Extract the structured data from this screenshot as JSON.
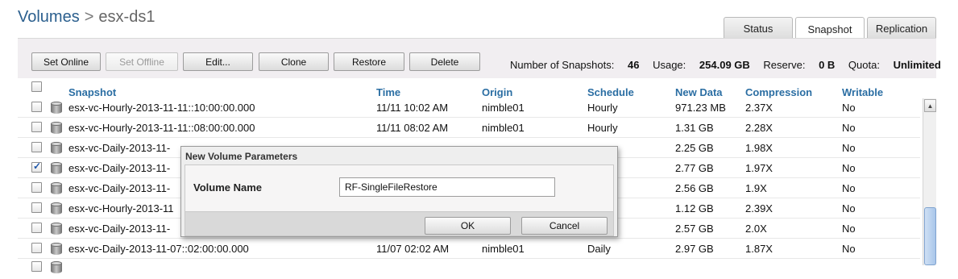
{
  "breadcrumb": {
    "root": "Volumes",
    "separator": ">",
    "current": "esx-ds1"
  },
  "tabs": [
    {
      "label": "Status",
      "active": false
    },
    {
      "label": "Snapshot",
      "active": true
    },
    {
      "label": "Replication",
      "active": false
    }
  ],
  "toolbar": {
    "set_online": "Set Online",
    "set_offline": "Set Offline",
    "edit": "Edit...",
    "clone": "Clone",
    "restore": "Restore",
    "delete": "Delete"
  },
  "stats": {
    "snapshots_label": "Number of Snapshots:",
    "snapshots_value": "46",
    "usage_label": "Usage:",
    "usage_value": "254.09 GB",
    "reserve_label": "Reserve:",
    "reserve_value": "0 B",
    "quota_label": "Quota:",
    "quota_value": "Unlimited"
  },
  "table": {
    "columns": [
      "Snapshot",
      "Time",
      "Origin",
      "Schedule",
      "New Data",
      "Compression",
      "Writable"
    ],
    "rows": [
      {
        "checked": false,
        "snapshot": "esx-vc-Hourly-2013-11-11::10:00:00.000",
        "time": "11/11 10:02 AM",
        "origin": "nimble01",
        "schedule": "Hourly",
        "new_data": "971.23 MB",
        "compression": "2.37X",
        "writable": "No"
      },
      {
        "checked": false,
        "snapshot": "esx-vc-Hourly-2013-11-11::08:00:00.000",
        "time": "11/11 08:02 AM",
        "origin": "nimble01",
        "schedule": "Hourly",
        "new_data": "1.31 GB",
        "compression": "2.28X",
        "writable": "No"
      },
      {
        "checked": false,
        "snapshot": "esx-vc-Daily-2013-11-",
        "time": "",
        "origin": "",
        "schedule": "",
        "new_data": "2.25 GB",
        "compression": "1.98X",
        "writable": "No"
      },
      {
        "checked": true,
        "snapshot": "esx-vc-Daily-2013-11-",
        "time": "",
        "origin": "",
        "schedule": "",
        "new_data": "2.77 GB",
        "compression": "1.97X",
        "writable": "No"
      },
      {
        "checked": false,
        "snapshot": "esx-vc-Daily-2013-11-",
        "time": "",
        "origin": "",
        "schedule": "",
        "new_data": "2.56 GB",
        "compression": "1.9X",
        "writable": "No"
      },
      {
        "checked": false,
        "snapshot": "esx-vc-Hourly-2013-11",
        "time": "",
        "origin": "",
        "schedule": "",
        "new_data": "1.12 GB",
        "compression": "2.39X",
        "writable": "No"
      },
      {
        "checked": false,
        "snapshot": "esx-vc-Daily-2013-11-",
        "time": "",
        "origin": "",
        "schedule": "",
        "new_data": "2.57 GB",
        "compression": "2.0X",
        "writable": "No"
      },
      {
        "checked": false,
        "snapshot": "esx-vc-Daily-2013-11-07::02:00:00.000",
        "time": "11/07 02:02 AM",
        "origin": "nimble01",
        "schedule": "Daily",
        "new_data": "2.97 GB",
        "compression": "1.87X",
        "writable": "No"
      }
    ]
  },
  "dialog": {
    "title": "New Volume Parameters",
    "field_label": "Volume Name",
    "field_value": "RF-SingleFileRestore",
    "ok": "OK",
    "cancel": "Cancel"
  }
}
